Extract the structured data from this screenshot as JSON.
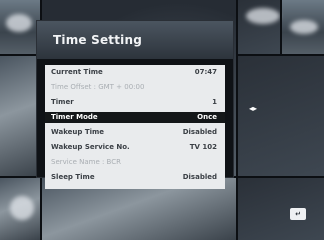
{
  "window": {
    "title": "Time Setting"
  },
  "menu": {
    "rows": [
      {
        "label": "Current Time",
        "value": "07:47"
      },
      {
        "label": "Time Offset : GMT + 00:00",
        "value": ""
      },
      {
        "label": "Timer",
        "value": "1"
      },
      {
        "label": "Timer Mode",
        "value": "Once"
      },
      {
        "label": "Wakeup Time",
        "value": "Disabled"
      },
      {
        "label": "Wakeup Service No.",
        "value": "TV 102"
      },
      {
        "label": "Service Name : BCR",
        "value": ""
      },
      {
        "label": "Sleep Time",
        "value": "Disabled"
      }
    ]
  },
  "hints": {
    "left_right": "◂▸",
    "exit_icon": "exit-icon"
  },
  "colors": {
    "panel_background": "#0f1216",
    "menu_background": "#e9ebed",
    "selected_row": "#141719"
  }
}
